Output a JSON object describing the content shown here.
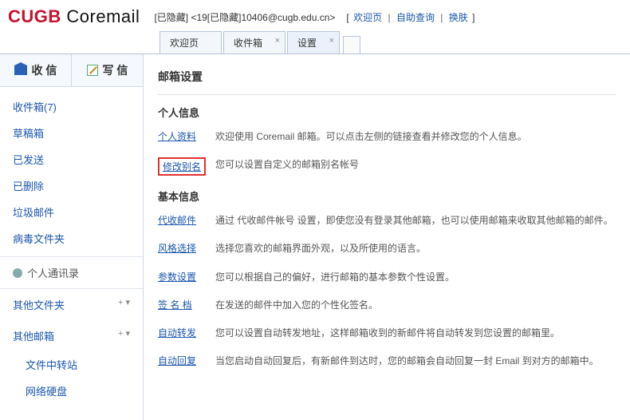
{
  "logo": {
    "cugb": "CUGB",
    "coremail": "Coremail"
  },
  "user_display": "[已隐藏] <19[已隐藏]10406@cugb.edu.cn>",
  "header_links": {
    "welcome": "欢迎页",
    "self_query": "自助查询",
    "skin": "换肤"
  },
  "tabs": [
    {
      "label": "欢迎页",
      "closable": false
    },
    {
      "label": "收件箱",
      "closable": true
    },
    {
      "label": "设置",
      "closable": true,
      "active": true
    }
  ],
  "toolbar": {
    "receive": "收 信",
    "compose": "写 信"
  },
  "folders": {
    "inbox": "收件箱(7)",
    "drafts": "草稿箱",
    "sent": "已发送",
    "trash": "已删除",
    "spam": "垃圾邮件",
    "virus": "病毒文件夹"
  },
  "contacts": "个人通讯录",
  "groups": {
    "other_folders": "其他文件夹",
    "other_mail": "其他邮箱",
    "transfer": "文件中转站",
    "netdisk": "网络硬盘"
  },
  "expander_symbol": "+ ▾",
  "content": {
    "page_title": "邮箱设置",
    "section_personal": "个人信息",
    "rows_personal": [
      {
        "link": "个人资料",
        "desc": "欢迎使用 Coremail 邮箱。可以点击左侧的链接查看并修改您的个人信息。"
      },
      {
        "link": "修改别名",
        "desc": "您可以设置自定义的邮箱别名帐号",
        "highlight": true
      }
    ],
    "section_basic": "基本信息",
    "rows_basic": [
      {
        "link": "代收邮件",
        "desc": "通过 代收邮件帐号 设置，即使您没有登录其他邮箱，也可以使用邮箱来收取其他邮箱的邮件。"
      },
      {
        "link": "风格选择",
        "desc": "选择您喜欢的邮箱界面外观，以及所使用的语言。"
      },
      {
        "link": "参数设置",
        "desc": "您可以根据自己的偏好，进行邮箱的基本参数个性设置。"
      },
      {
        "link": "签 名 档",
        "desc": "在发送的邮件中加入您的个性化签名。"
      },
      {
        "link": "自动转发",
        "desc": "您可以设置自动转发地址，这样邮箱收到的新邮件将自动转发到您设置的邮箱里。"
      },
      {
        "link": "自动回复",
        "desc": "当您启动自动回复后，有新邮件到达时，您的邮箱会自动回复一封 Email 到对方的邮箱中。"
      }
    ]
  }
}
